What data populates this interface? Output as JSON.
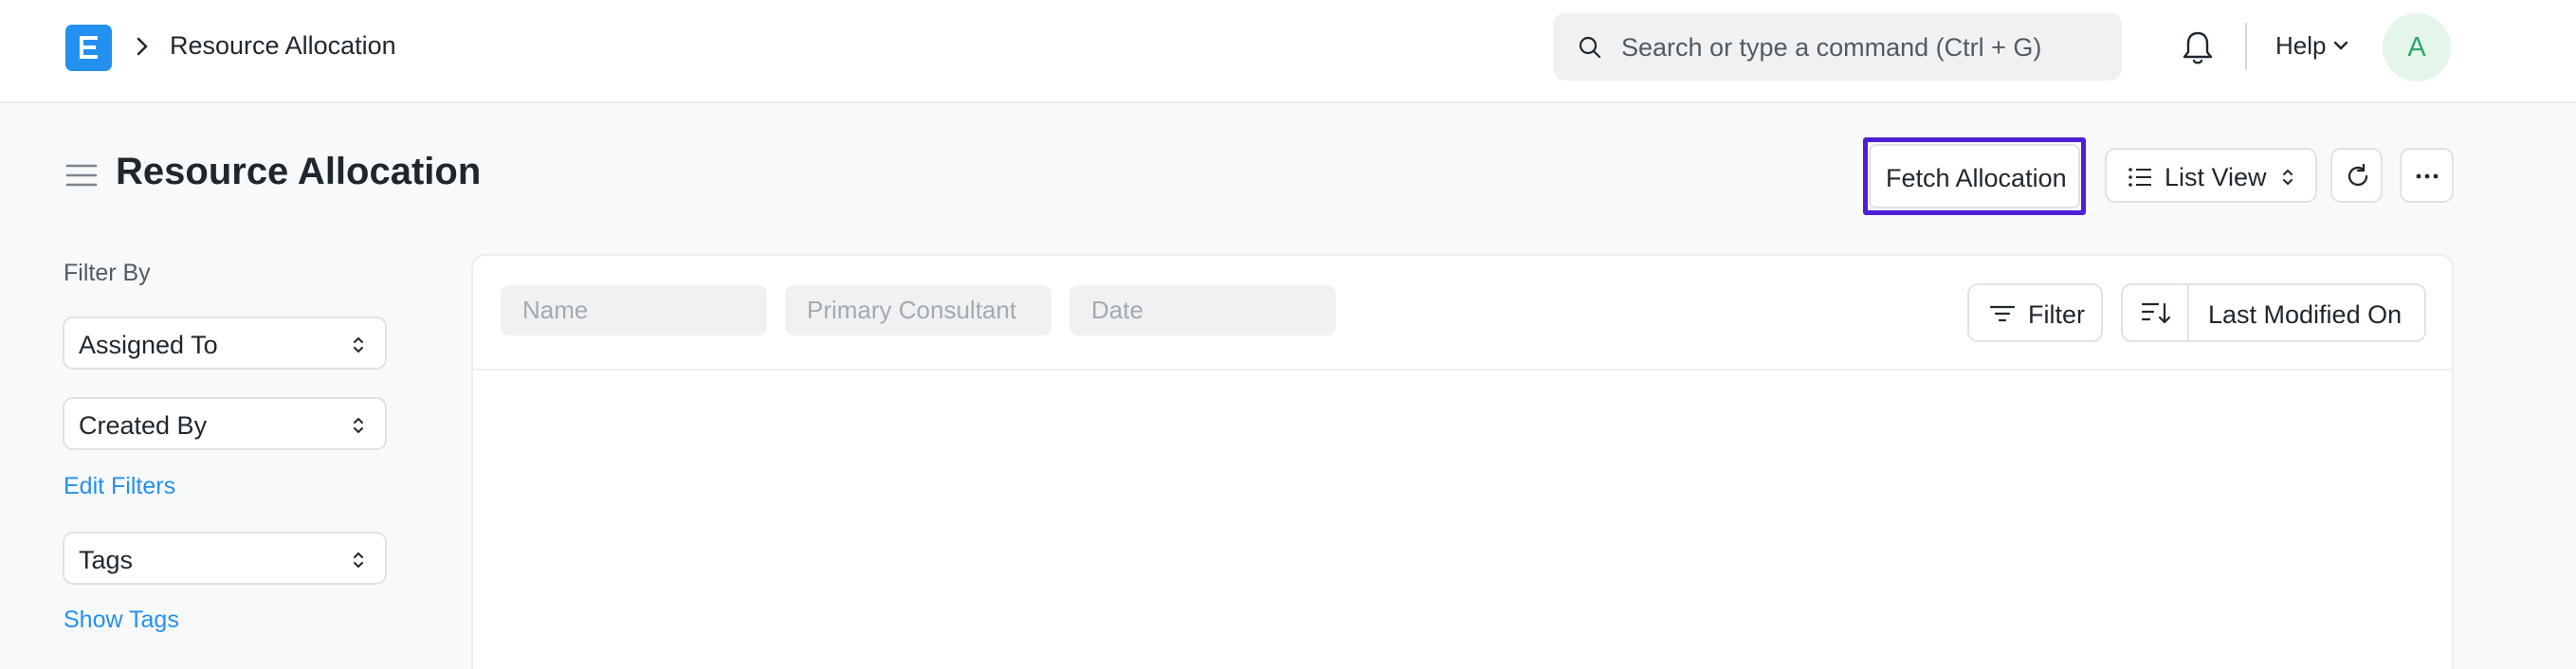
{
  "navbar": {
    "logo_icon": "erpnext-logo",
    "breadcrumb": "Resource Allocation",
    "search_placeholder": "Search or type a command (Ctrl + G)",
    "help_label": "Help",
    "avatar_initial": "A"
  },
  "page": {
    "title": "Resource Allocation",
    "fetch_button": "Fetch Allocation",
    "list_view_button": "List View"
  },
  "sidebar": {
    "filter_by": "Filter By",
    "assigned_to": "Assigned To",
    "created_by": "Created By",
    "edit_filters": "Edit Filters",
    "tags": "Tags",
    "show_tags": "Show Tags"
  },
  "list": {
    "filters": {
      "name_placeholder": "Name",
      "consultant_placeholder": "Primary Consultant",
      "date_placeholder": "Date"
    },
    "filter_button": "Filter",
    "sort_label": "Last Modified On"
  },
  "colors": {
    "accent": "#2490ef",
    "highlight": "#4f1ed6",
    "avatar_bg": "#e4f5e9",
    "avatar_text": "#30a66d"
  }
}
